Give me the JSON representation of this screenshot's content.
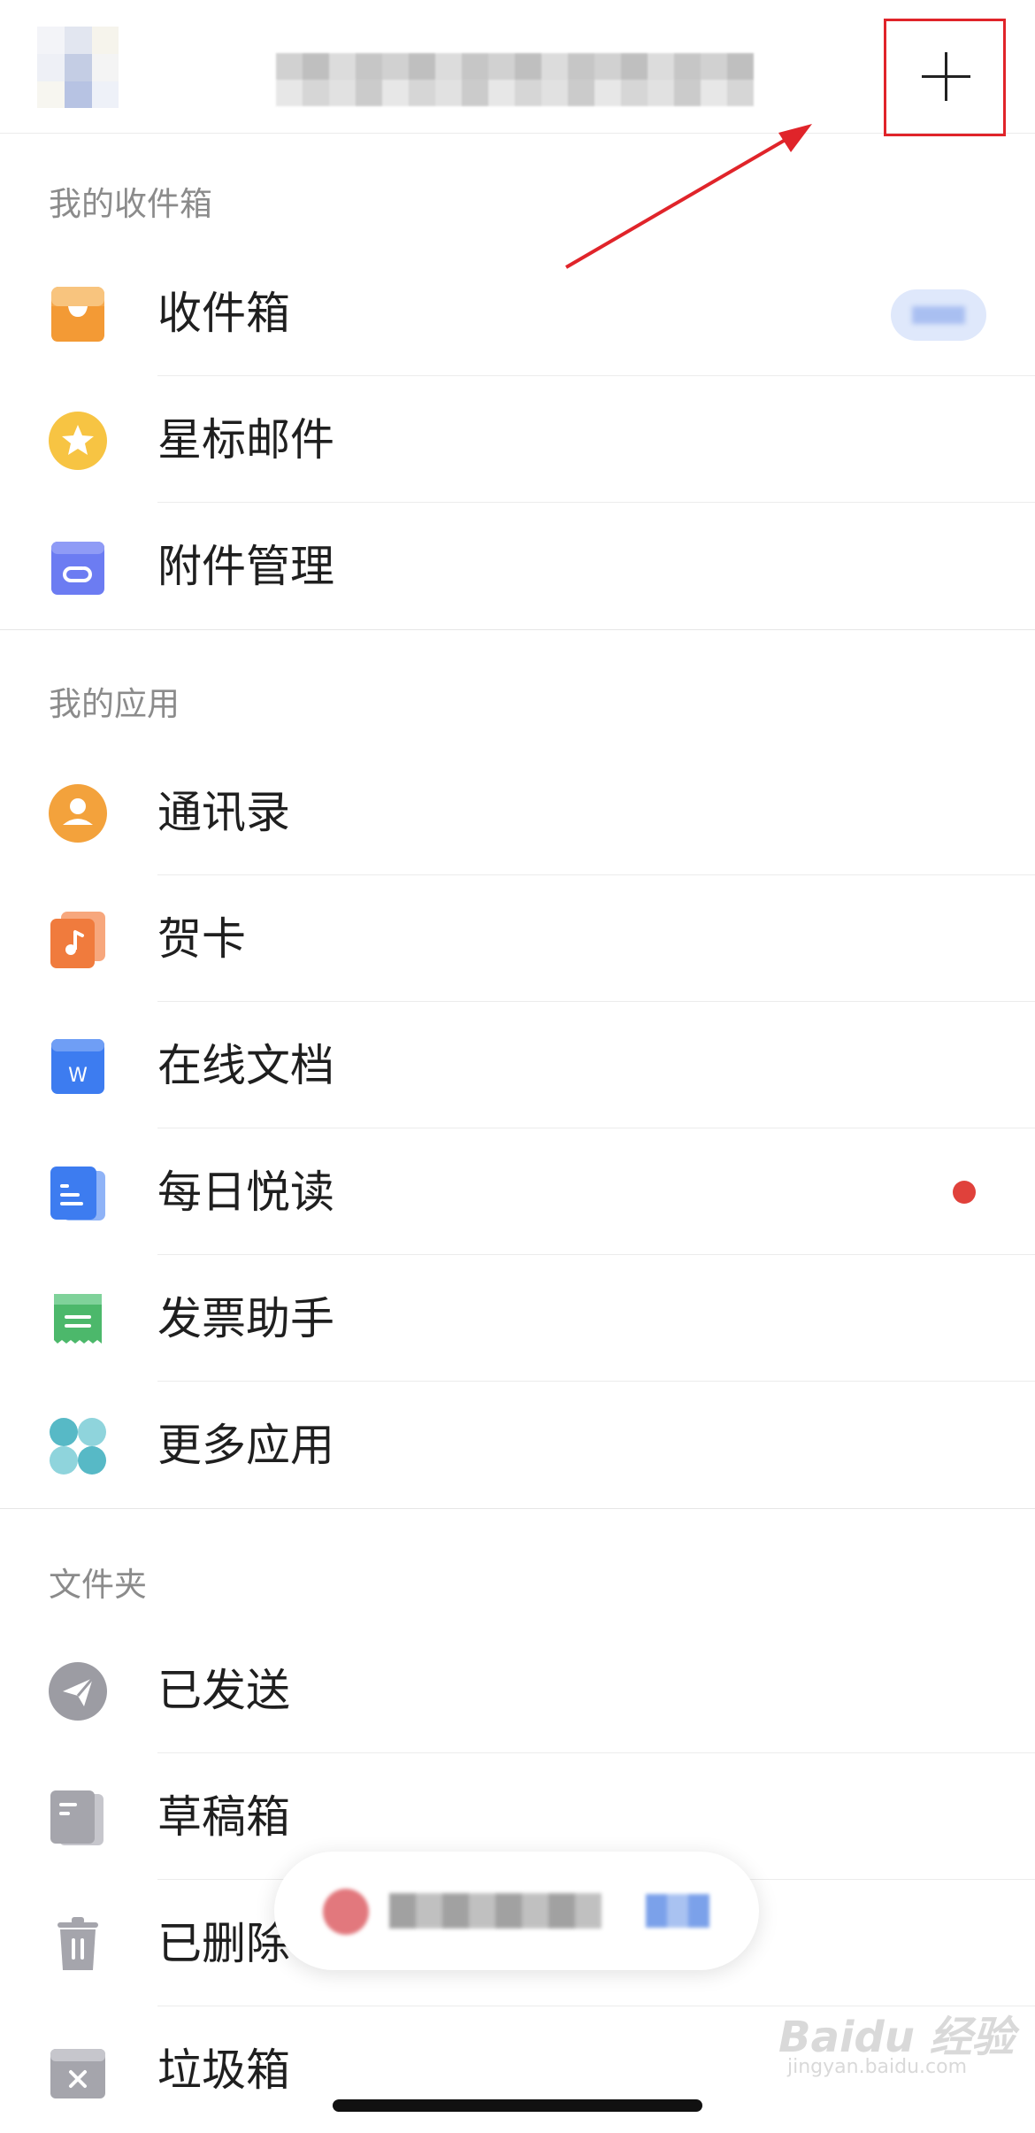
{
  "sections": {
    "mailbox": "我的收件箱",
    "apps": "我的应用",
    "folders": "文件夹"
  },
  "mailbox_items": [
    {
      "label": "收件箱",
      "icon": "inbox-tray-icon"
    },
    {
      "label": "星标邮件",
      "icon": "star-icon"
    },
    {
      "label": "附件管理",
      "icon": "attachment-clip-icon"
    }
  ],
  "app_items": [
    {
      "label": "通讯录",
      "icon": "contacts-person-icon"
    },
    {
      "label": "贺卡",
      "icon": "greeting-card-music-icon"
    },
    {
      "label": "在线文档",
      "icon": "word-document-icon"
    },
    {
      "label": "每日悦读",
      "icon": "reading-list-icon"
    },
    {
      "label": "发票助手",
      "icon": "invoice-receipt-icon"
    },
    {
      "label": "更多应用",
      "icon": "more-apps-grid-icon"
    }
  ],
  "folder_items": [
    {
      "label": "已发送",
      "icon": "paper-plane-icon"
    },
    {
      "label": "草稿箱",
      "icon": "drafts-icon"
    },
    {
      "label": "已删除",
      "icon": "trash-can-icon"
    },
    {
      "label": "垃圾箱",
      "icon": "spam-box-icon"
    }
  ],
  "watermark": {
    "brand": "Baidu 经验",
    "url": "jingyan.baidu.com"
  },
  "colors": {
    "annotation_red": "#e0242a",
    "unread_dot": "#e0413b"
  }
}
